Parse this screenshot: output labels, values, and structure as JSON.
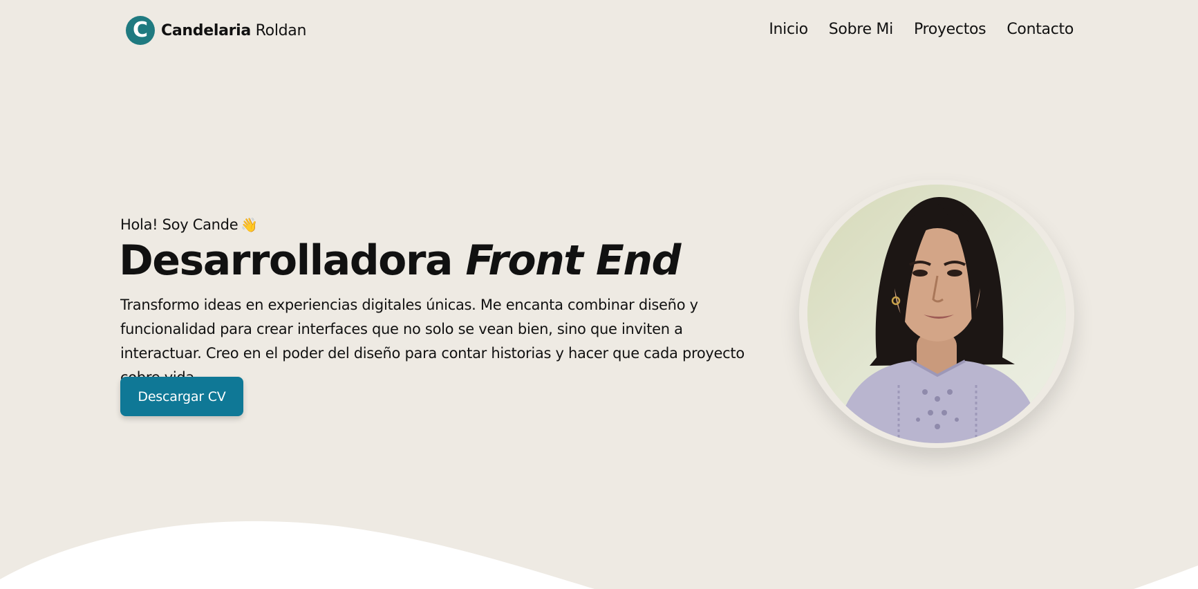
{
  "brand": {
    "logo_letter": "C",
    "first": "Candelaria",
    "last": "Roldan",
    "logo_color": "#1f7a80"
  },
  "nav": {
    "items": [
      "Inicio",
      "Sobre Mi",
      "Proyectos",
      "Contacto"
    ]
  },
  "hero": {
    "greeting": "Hola! Soy Cande",
    "greeting_icon": "waving-hand-icon",
    "headline_plain": "Desarrolladora",
    "headline_emphasis": "Front End",
    "intro": "Transformo ideas en experiencias digitales únicas. Me encanta combinar diseño y funcionalidad para crear interfaces que no solo se vean bien, sino que inviten a interactuar. Creo en el poder del diseño para contar historias y hacer que cada proyecto cobre vida.",
    "cta_label": "Descargar CV",
    "cta_color": "#0f7896",
    "portrait_icon": "profile-photo"
  },
  "colors": {
    "background": "#eeeae3",
    "wave": "#ffffff"
  }
}
